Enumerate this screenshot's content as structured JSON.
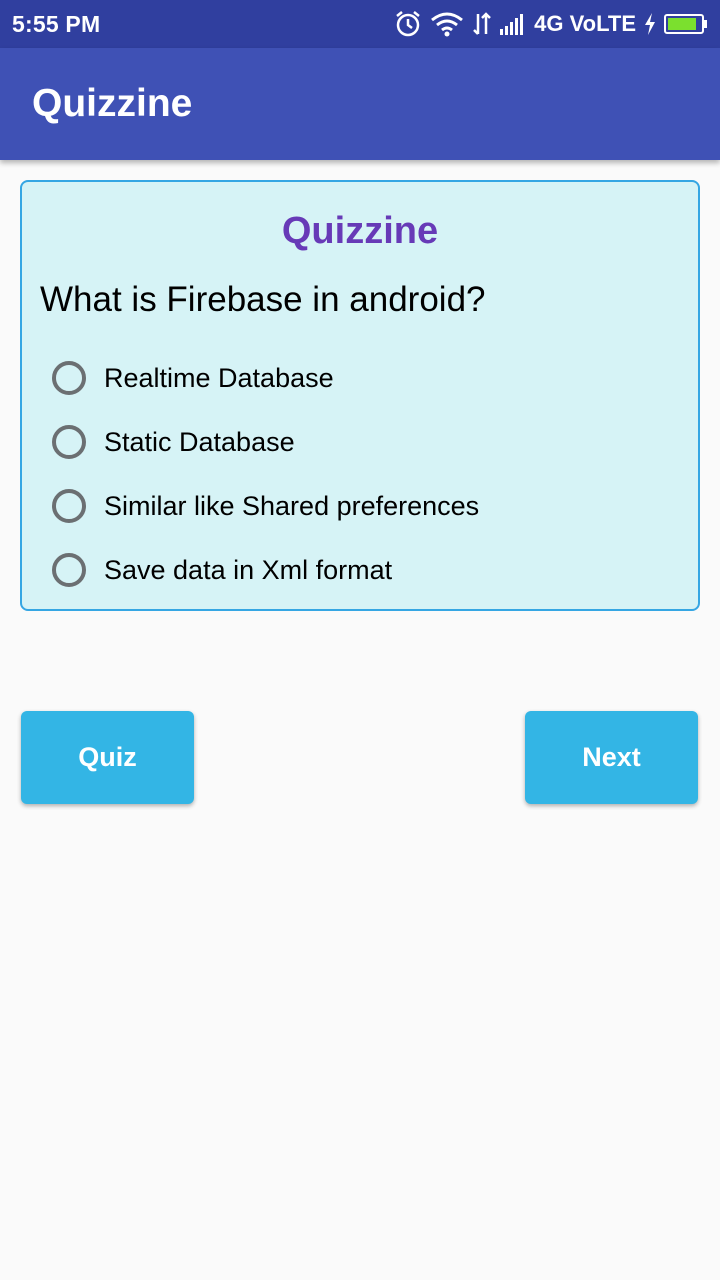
{
  "status_bar": {
    "time": "5:55 PM",
    "network_label": "4G VoLTE",
    "icons": [
      "alarm-icon",
      "wifi-icon",
      "data-arrows-icon",
      "signal-icon",
      "charging-icon",
      "battery-icon"
    ]
  },
  "app_bar": {
    "title": "Quizzine"
  },
  "quiz": {
    "title": "Quizzine",
    "question": "What is Firebase in android?",
    "options": [
      {
        "label": "Realtime Database"
      },
      {
        "label": "Static Database"
      },
      {
        "label": "Similar like Shared preferences"
      },
      {
        "label": "Save data in Xml format"
      }
    ]
  },
  "buttons": {
    "quiz_label": "Quiz",
    "next_label": "Next"
  },
  "colors": {
    "status_bar": "#303f9f",
    "app_bar": "#3f51b5",
    "card_background": "#d6f3f6",
    "card_border": "#35a6e3",
    "card_title": "#673ab7",
    "button": "#33b5e5",
    "battery": "#7be02e"
  }
}
